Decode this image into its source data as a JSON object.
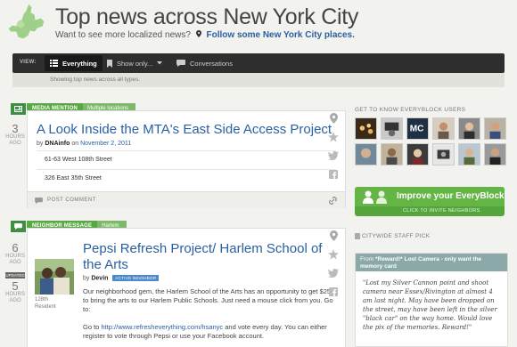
{
  "header": {
    "title": "Top news across New York City",
    "subtitle_prefix": "Want to see more localized news?",
    "subtitle_link": "Follow some New York City places."
  },
  "toolbar": {
    "view_label": "VIEW:",
    "buttons": [
      {
        "label": "Everything",
        "active": true
      },
      {
        "label": "Show only...",
        "active": false
      },
      {
        "label": "Conversations",
        "active": false
      }
    ],
    "status": "Showing top news across all types."
  },
  "articles": [
    {
      "age_num": "3",
      "age_unit": "HOURS AGO",
      "tag": "MEDIA MENTION",
      "location": "Multiple locations",
      "title": "A Look Inside the MTA's East Side Access Project",
      "by": "by",
      "author": "DNAinfo",
      "on": "on",
      "date": "November 2, 2011",
      "addresses": [
        "61-63 West 108th Street",
        "326 East 35th Street"
      ],
      "comment_label": "POST COMMENT"
    },
    {
      "age_num": "6",
      "age_unit": "HOURS AGO",
      "updated_label": "UPDATED",
      "updated_num": "5",
      "updated_unit": "HOURS AGO",
      "tag": "NEIGHBOR MESSAGE",
      "location": "Harlem",
      "title": "Pepsi Refresh Project/ Harlem School of the Arts",
      "by": "by",
      "author": "Devin",
      "badge": "ACTIVE NEIGHBOR",
      "resident": "128th Resident",
      "paragraph1": "Our neighborhood gem, the Harlem School of the Arts has an opportunity to get $25k to bring the arts to our Harlem Public Schools. Just need a mouse click from you. Go to:",
      "paragraph2_prefix": "Go to",
      "paragraph2_link": "http://www.refresheverything.com/hsanyc",
      "paragraph2_suffix": "and vote every day. You can either register to vote through Pepsi or use your Facebook account."
    }
  ],
  "sidebar": {
    "users_heading": "GET TO KNOW EVERYBLOCK USERS",
    "improve_label": "Improve your EveryBlock",
    "improve_sub": "CLICK TO INVITE NEIGHBORS",
    "pick_heading": "CITYWIDE STAFF PICK",
    "pick_from": "From",
    "pick_title": "*Reward!* Lost Camera - only want the memory card",
    "pick_quote": "\"Lost my Silver Cannon point and shoot camera near Essex/Rivington at almost 4 am last night. May have been dropped on the street, may have been left in the silver \"black car\" on the way home. Would love the pix of the memories. Reward!\""
  },
  "colors": {
    "accent_blue": "#2a5fa0",
    "tag_green": "#5aa845",
    "toolbar_dark": "#2e2e2e"
  }
}
